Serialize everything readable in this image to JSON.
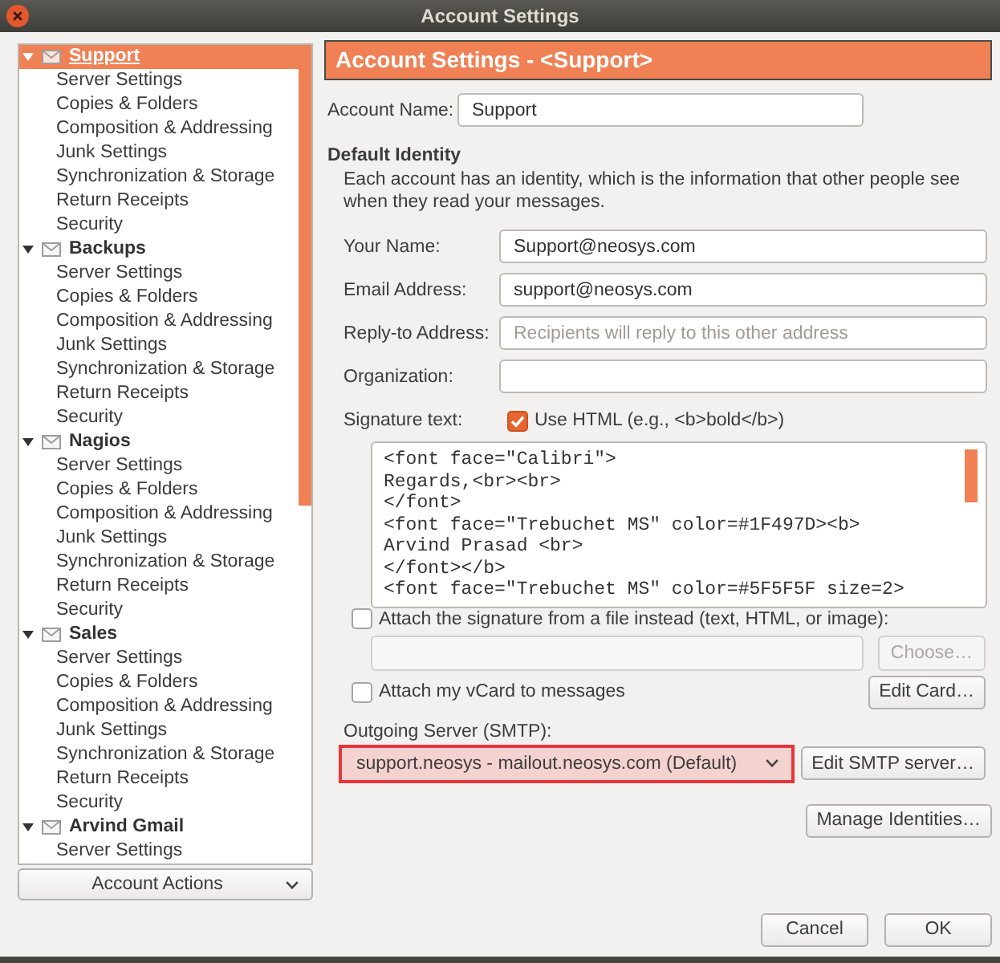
{
  "window": {
    "title": "Account Settings"
  },
  "sidebar": {
    "accounts": [
      {
        "name": "Support",
        "selected": true,
        "expanded": true,
        "items": [
          {
            "label": "Server Settings",
            "selected": false
          },
          {
            "label": "Copies & Folders",
            "selected": false
          },
          {
            "label": "Composition & Addressing",
            "selected": false
          },
          {
            "label": "Junk Settings",
            "selected": false
          },
          {
            "label": "Synchronization & Storage",
            "selected": false
          },
          {
            "label": "Return Receipts",
            "selected": false
          },
          {
            "label": "Security",
            "selected": false
          }
        ]
      },
      {
        "name": "Backups",
        "selected": false,
        "expanded": true,
        "items": [
          {
            "label": "Server Settings",
            "selected": false
          },
          {
            "label": "Copies & Folders",
            "selected": false
          },
          {
            "label": "Composition & Addressing",
            "selected": false
          },
          {
            "label": "Junk Settings",
            "selected": false
          },
          {
            "label": "Synchronization & Storage",
            "selected": false
          },
          {
            "label": "Return Receipts",
            "selected": false
          },
          {
            "label": "Security",
            "selected": false
          }
        ]
      },
      {
        "name": "Nagios",
        "selected": false,
        "expanded": true,
        "items": [
          {
            "label": "Server Settings",
            "selected": false
          },
          {
            "label": "Copies & Folders",
            "selected": false
          },
          {
            "label": "Composition & Addressing",
            "selected": false
          },
          {
            "label": "Junk Settings",
            "selected": false
          },
          {
            "label": "Synchronization & Storage",
            "selected": false
          },
          {
            "label": "Return Receipts",
            "selected": false
          },
          {
            "label": "Security",
            "selected": false
          }
        ]
      },
      {
        "name": "Sales",
        "selected": false,
        "expanded": true,
        "items": [
          {
            "label": "Server Settings",
            "selected": false
          },
          {
            "label": "Copies & Folders",
            "selected": false
          },
          {
            "label": "Composition & Addressing",
            "selected": false
          },
          {
            "label": "Junk Settings",
            "selected": false
          },
          {
            "label": "Synchronization & Storage",
            "selected": false
          },
          {
            "label": "Return Receipts",
            "selected": false
          },
          {
            "label": "Security",
            "selected": false
          }
        ]
      },
      {
        "name": "Arvind Gmail",
        "selected": false,
        "expanded": true,
        "items": [
          {
            "label": "Server Settings",
            "selected": false
          }
        ]
      }
    ],
    "account_actions": "Account Actions"
  },
  "panel": {
    "title": "Account Settings - <Support>",
    "account_name": {
      "label": "Account Name:",
      "value": "Support"
    },
    "identity": {
      "heading": "Default Identity",
      "description": "Each account has an identity, which is the information that other people see when they read your messages.",
      "fields": [
        {
          "label": "Your Name:",
          "value": "Support@neosys.com"
        },
        {
          "label": "Email Address:",
          "value": "support@neosys.com"
        },
        {
          "label": "Reply-to Address:",
          "placeholder": "Recipients will reply to this other address"
        },
        {
          "label": "Organization:"
        }
      ]
    },
    "signature": {
      "label": "Signature text:",
      "use_html": {
        "label": "Use HTML (e.g., <b>bold</b>)",
        "checked": true
      },
      "text": "<font face=\"Calibri\">\nRegards,<br><br>\n</font>\n<font face=\"Trebuchet MS\" color=#1F497D><b>\nArvind Prasad <br>\n</font></b>\n<font face=\"Trebuchet MS\" color=#5F5F5F size=2>",
      "attach_file": {
        "label": "Attach the signature from a file instead (text, HTML, or image):",
        "checked": false
      },
      "file_field": {
        "disabled": true
      },
      "choose_button": {
        "label": "Choose…",
        "disabled": true
      }
    },
    "vcard": {
      "label": "Attach my vCard to messages",
      "checked": false,
      "edit_button": "Edit Card…"
    },
    "smtp": {
      "label": "Outgoing Server (SMTP):",
      "value": "support.neosys - mailout.neosys.com (Default)",
      "highlighted": true,
      "edit_button": "Edit SMTP server…"
    },
    "manage_identities": "Manage Identities…"
  },
  "buttons": [
    {
      "label": "Cancel"
    },
    {
      "label": "OK"
    }
  ]
}
